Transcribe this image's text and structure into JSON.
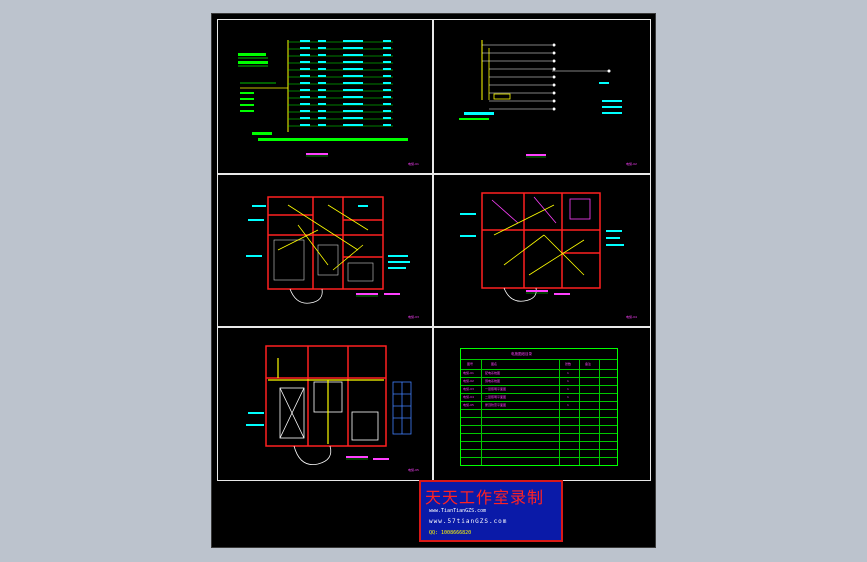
{
  "sheet": {
    "panels": [
      {
        "id": "p1",
        "caption": "配电系统图",
        "code": "电施-01"
      },
      {
        "id": "p2",
        "caption": "弱电系统图",
        "code": "电施-02"
      },
      {
        "id": "p3",
        "caption": "一层照明平面图",
        "code": "电施-03"
      },
      {
        "id": "p4",
        "caption": "二层照明平面图",
        "code": "电施-04"
      },
      {
        "id": "p5",
        "caption": "屋顶防雷平面图",
        "code": "电施-05"
      },
      {
        "id": "p6",
        "caption": "图纸目录",
        "code": ""
      }
    ],
    "table": {
      "title": "电施图纸目录",
      "headers": [
        "图号",
        "图名",
        "张数",
        "备注"
      ],
      "rows": [
        [
          "电施-01",
          "配电系统图",
          "1",
          ""
        ],
        [
          "电施-02",
          "弱电系统图",
          "1",
          ""
        ],
        [
          "电施-03",
          "一层照明平面图",
          "1",
          ""
        ],
        [
          "电施-04",
          "二层照明平面图",
          "1",
          ""
        ],
        [
          "电施-05",
          "屋顶防雷平面图",
          "1",
          ""
        ]
      ]
    }
  },
  "stamp": {
    "title": "天天工作室录制",
    "line1": "www.TianTianGZS.com",
    "line2": "www.57tianGZS.com",
    "line3": "QQ: 1008666820"
  },
  "colors": {
    "background": "#bcc3cd",
    "sheet": "#000000",
    "wall": "#ff2020",
    "wire": "#ffff00",
    "label": "#00ffff",
    "text": "#ff40ff",
    "grid": "#00ff00"
  }
}
